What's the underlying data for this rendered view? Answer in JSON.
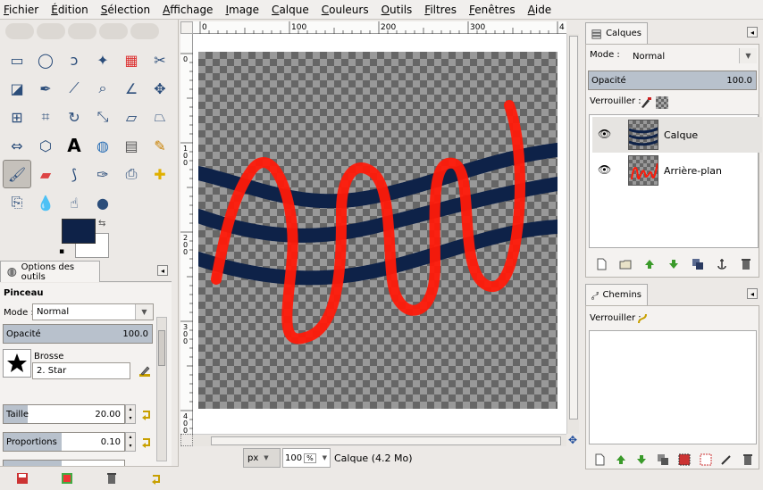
{
  "menu": [
    "Fichier",
    "Édition",
    "Sélection",
    "Affichage",
    "Image",
    "Calque",
    "Couleurs",
    "Outils",
    "Filtres",
    "Fenêtres",
    "Aide"
  ],
  "tool_icons": [
    "rect-select-icon",
    "ellipse-select-icon",
    "lasso-icon",
    "fuzzy-select-icon",
    "color-select-icon",
    "scissors-icon",
    "foreground-select-icon",
    "paths-icon",
    "color-picker-icon",
    "zoom-icon",
    "measure-icon",
    "move-icon",
    "align-icon",
    "crop-icon",
    "rotate-icon",
    "scale-icon",
    "shear-icon",
    "perspective-icon",
    "flip-icon",
    "cage-icon",
    "text-icon",
    "bucket-fill-icon",
    "gradient-icon",
    "pencil-icon",
    "paintbrush-icon",
    "eraser-icon",
    "airbrush-icon",
    "ink-icon",
    "clone-icon",
    "heal-icon",
    "perspective-clone-icon",
    "blur-icon",
    "smudge-icon",
    "dodge-burn-icon"
  ],
  "colors": {
    "foreground": "#0e2248",
    "background": "#ffffff"
  },
  "tool_options": {
    "tab_label": "Options des outils",
    "title": "Pinceau",
    "mode_label": "Mode :",
    "mode_value": "Normal",
    "opacity_label": "Opacité",
    "opacity_value": "100.0",
    "brush_label": "Brosse",
    "brush_value": "2. Star",
    "size_label": "Taille",
    "size_value": "20.00",
    "ratio_label": "Proportions",
    "ratio_value": "0.10"
  },
  "rulers": {
    "h_ticks": [
      "0",
      "100",
      "200",
      "300",
      "4"
    ],
    "v_ticks": [
      "0",
      "1\n0\n0",
      "2\n0\n0",
      "3\n0\n0",
      "4\n0\n0"
    ]
  },
  "status": {
    "unit": "px",
    "zoom": "100",
    "zoom_suffix": "%",
    "text": "Calque (4.2 Mo)"
  },
  "layers_panel": {
    "tab_label": "Calques",
    "mode_label": "Mode :",
    "mode_value": "Normal",
    "opacity_label": "Opacité",
    "opacity_value": "100.0",
    "lock_label": "Verrouiller :",
    "layers": [
      {
        "name": "Calque",
        "visible": true
      },
      {
        "name": "Arrière-plan",
        "visible": true
      }
    ]
  },
  "paths_panel": {
    "tab_label": "Chemins",
    "lock_label": "Verrouiller :"
  },
  "accent": {
    "red_stroke": "#ff1a0a",
    "navy_stroke": "#0e2248"
  }
}
